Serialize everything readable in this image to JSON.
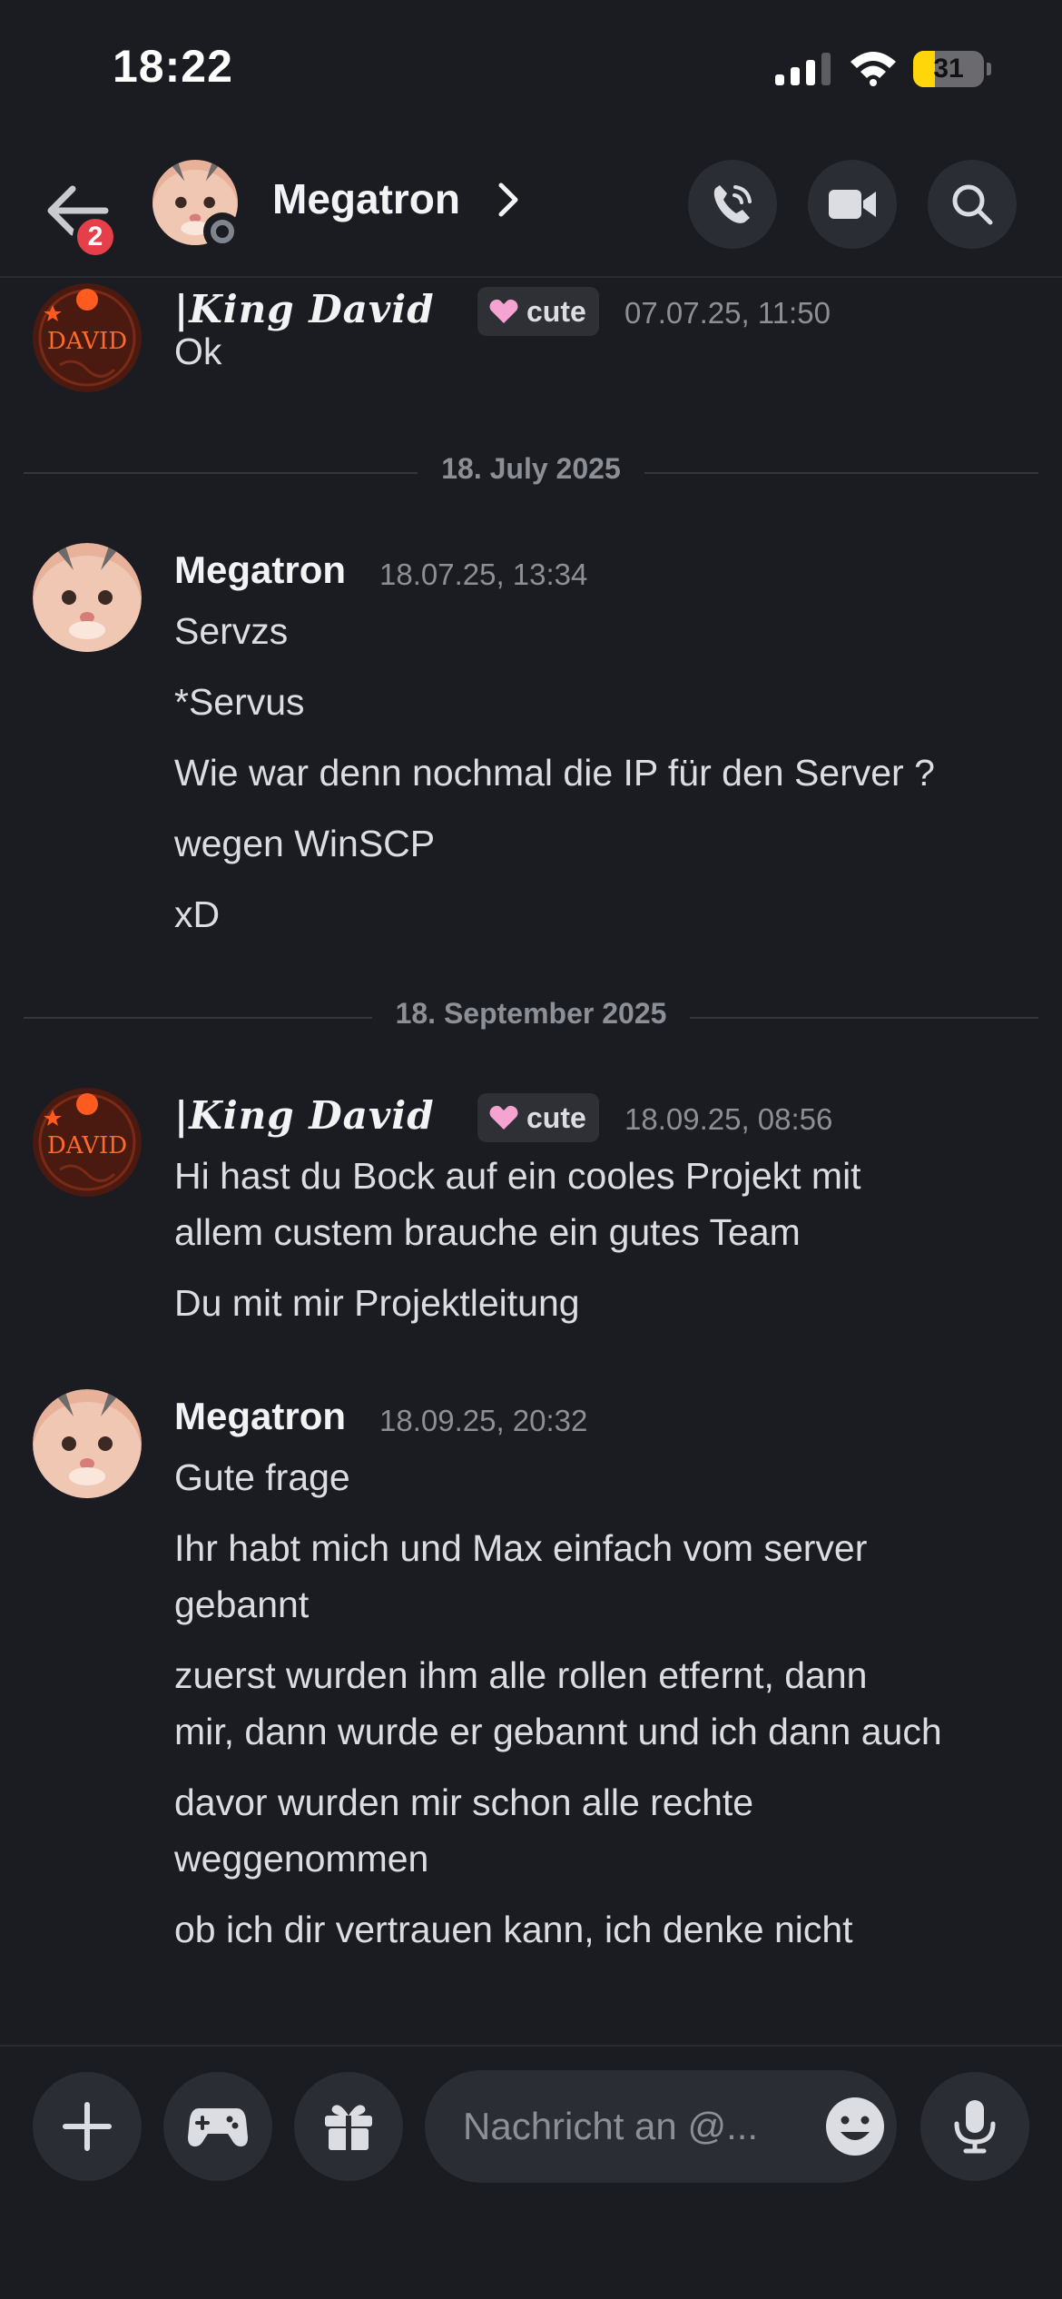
{
  "status_bar": {
    "time": "18:22",
    "battery": "31",
    "battery_level": 0.31
  },
  "header": {
    "title": "Megatron",
    "back_badge": "2"
  },
  "colors": {
    "background": "#1b1c21",
    "badge": "#e5404a",
    "battery": "#ffd60a",
    "tag_heart": "#f5a3d0"
  },
  "messages": {
    "m0": {
      "author": "|King David",
      "tag": "cute",
      "time": "07.07.25, 11:50",
      "lines": [
        "Ok"
      ]
    },
    "d1": {
      "label": "18. July 2025"
    },
    "m1": {
      "author": "Megatron",
      "time": "18.07.25, 13:34",
      "lines": [
        "Servzs",
        "*Servus",
        "Wie war denn nochmal die IP für den Server ?",
        "wegen WinSCP",
        "xD"
      ]
    },
    "d2": {
      "label": "18. September 2025"
    },
    "m2": {
      "author": "|King David",
      "tag": "cute",
      "time": "18.09.25, 08:56",
      "lines": [
        "Hi hast du Bock auf ein cooles Projekt mit",
        "allem custem brauche ein gutes Team",
        "Du mit mir Projektleitung"
      ]
    },
    "m3": {
      "author": "Megatron",
      "time": "18.09.25, 20:32",
      "lines": [
        "Gute frage",
        "Ihr habt mich und Max einfach vom server",
        "gebannt",
        "zuerst wurden ihm alle rollen etfernt, dann",
        "mir, dann wurde er gebannt und ich dann auch",
        "davor wurden mir schon alle rechte",
        "weggenommen",
        "ob ich dir vertrauen kann, ich denke nicht"
      ]
    }
  },
  "avatars": {
    "david_text": "DAVID"
  },
  "input": {
    "placeholder": "Nachricht an @..."
  },
  "icons": {
    "back": "arrow-left-icon",
    "call": "phone-icon",
    "video": "video-camera-icon",
    "search": "search-icon",
    "add": "plus-icon",
    "games": "gamepad-icon",
    "gift": "gift-icon",
    "emoji": "emoji-icon",
    "mic": "microphone-icon"
  }
}
